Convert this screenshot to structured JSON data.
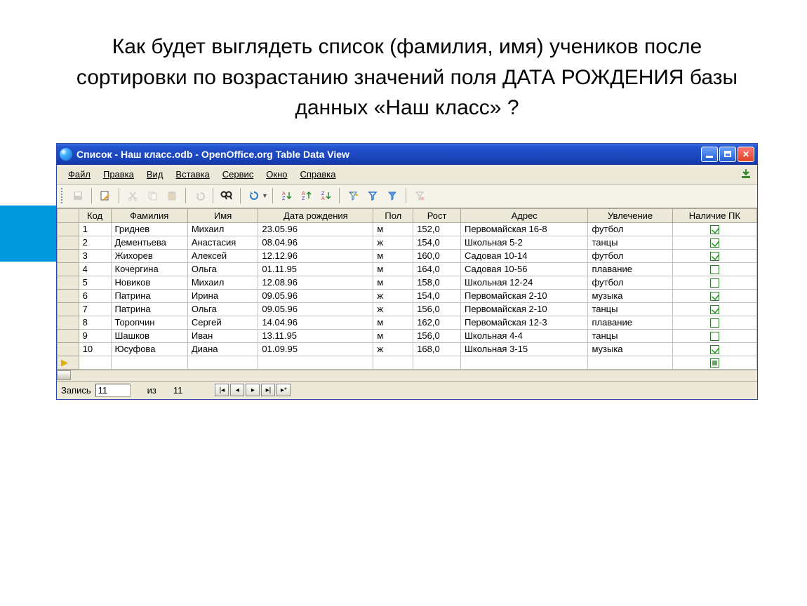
{
  "question_text": "Как будет выглядеть список (фамилия, имя) учеников после сортировки по возрастанию значений поля ДАТА РОЖДЕНИЯ базы данных «Наш класс» ?",
  "window": {
    "title": "Список - Наш класс.odb - OpenOffice.org Table Data View"
  },
  "menu": {
    "file": "Файл",
    "edit": "Правка",
    "view": "Вид",
    "insert": "Вставка",
    "service": "Сервис",
    "window": "Окно",
    "help": "Справка"
  },
  "columns": {
    "code": "Код",
    "surname": "Фамилия",
    "name": "Имя",
    "dob": "Дата рождения",
    "sex": "Пол",
    "height": "Рост",
    "address": "Адрес",
    "hobby": "Увлечение",
    "pc": "Наличие ПК"
  },
  "rows": [
    {
      "code": "1",
      "surname": "Гриднев",
      "name": "Михаил",
      "dob": "23.05.96",
      "sex": "м",
      "height": "152,0",
      "address": "Первомайская 16-8",
      "hobby": "футбол",
      "pc": true
    },
    {
      "code": "2",
      "surname": "Дементьева",
      "name": "Анастасия",
      "dob": "08.04.96",
      "sex": "ж",
      "height": "154,0",
      "address": "Школьная 5-2",
      "hobby": "танцы",
      "pc": true
    },
    {
      "code": "3",
      "surname": "Жихорев",
      "name": "Алексей",
      "dob": "12.12.96",
      "sex": "м",
      "height": "160,0",
      "address": "Садовая 10-14",
      "hobby": "футбол",
      "pc": true
    },
    {
      "code": "4",
      "surname": "Кочергина",
      "name": "Ольга",
      "dob": "01.11.95",
      "sex": "м",
      "height": "164,0",
      "address": "Садовая 10-56",
      "hobby": "плавание",
      "pc": false
    },
    {
      "code": "5",
      "surname": "Новиков",
      "name": "Михаил",
      "dob": "12.08.96",
      "sex": "м",
      "height": "158,0",
      "address": "Школьная 12-24",
      "hobby": "футбол",
      "pc": false
    },
    {
      "code": "6",
      "surname": "Патрина",
      "name": "Ирина",
      "dob": "09.05.96",
      "sex": "ж",
      "height": "154,0",
      "address": "Первомайская 2-10",
      "hobby": "музыка",
      "pc": true
    },
    {
      "code": "7",
      "surname": "Патрина",
      "name": "Ольга",
      "dob": "09.05.96",
      "sex": "ж",
      "height": "156,0",
      "address": "Первомайская 2-10",
      "hobby": "танцы",
      "pc": true
    },
    {
      "code": "8",
      "surname": "Торопчин",
      "name": "Сергей",
      "dob": "14.04.96",
      "sex": "м",
      "height": "162,0",
      "address": "Первомайская 12-3",
      "hobby": "плавание",
      "pc": false
    },
    {
      "code": "9",
      "surname": "Шашков",
      "name": "Иван",
      "dob": "13.11.95",
      "sex": "м",
      "height": "156,0",
      "address": "Школьная 4-4",
      "hobby": "танцы",
      "pc": false
    },
    {
      "code": "10",
      "surname": "Юсуфова",
      "name": "Диана",
      "dob": "01.09.95",
      "sex": "ж",
      "height": "168,0",
      "address": "Школьная 3-15",
      "hobby": "музыка",
      "pc": true
    }
  ],
  "status": {
    "record_label": "Запись",
    "record_value": "11",
    "of_label": "из",
    "total": "11"
  }
}
